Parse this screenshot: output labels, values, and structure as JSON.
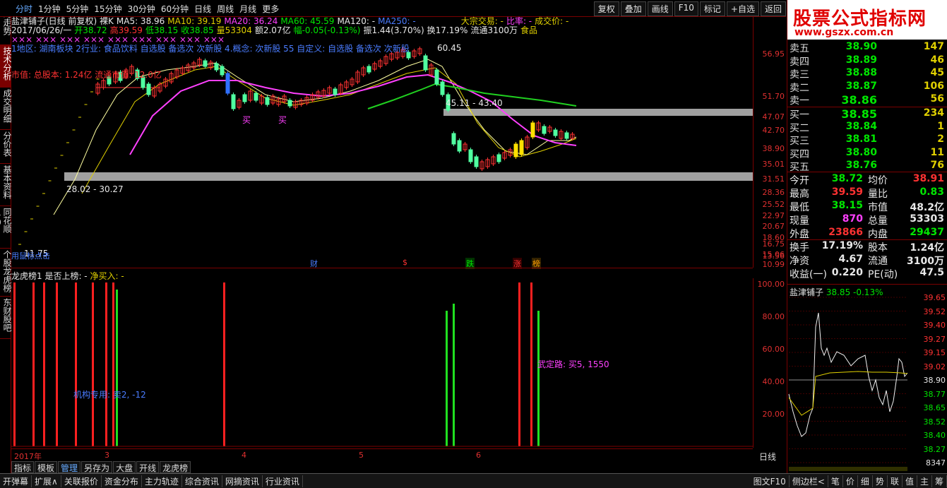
{
  "period_tabs": [
    "分时",
    "1分钟",
    "5分钟",
    "15分钟",
    "30分钟",
    "60分钟",
    "日线",
    "周线",
    "月线",
    "更多"
  ],
  "active_period": "分时",
  "toolbar": [
    "复权",
    "叠加",
    "画线",
    "F10",
    "标记",
    "+自选",
    "返回"
  ],
  "side_tabs": [
    "分时走势",
    "技术分析",
    "成交明细",
    "分价表",
    "基本资料",
    "同花顺10",
    "个股龙虎榜",
    "东财股吧"
  ],
  "active_side_tab": "技术分析",
  "header": {
    "title": "盐津铺子(日线 前复权) 裸K",
    "ma5": "MA5: 38.96",
    "ma10": "MA10: 39.19",
    "ma20": "MA20: 36.24",
    "ma60": "MA60: 45.59",
    "ma120": "MA120: -",
    "ma250": "MA250: -",
    "big_trade": "大宗交易: -",
    "ratio": "比率: -",
    "deal_price": "成交价: -",
    "date": "2017/06/26/一",
    "open": "开38.72",
    "high": "高39.59",
    "low": "低38.15",
    "close": "收38.85",
    "volume": "量53304",
    "amount": "额2.07亿",
    "change": "幅-0.05(-0.13%)",
    "amplitude": "振1.44(3.70%)",
    "turnover": "换17.19%",
    "float": "流通3100万",
    "industry_tag": "食品",
    "tags_line": "1地区: 湖南板块 2行业: 食品饮料 自选股 备选次 次新股 4.概念: 次新股 55 自定义: 自选股 备选次 次新股",
    "market_cap": "市值: 总股本: 1.24亿 流通市值: 12.0亿",
    "buy_marks": [
      "买",
      "买"
    ],
    "range_label_high": "45.11 - 43.40",
    "range_label_low": "28.02 - 30.27",
    "peak_label": "60.45",
    "low_label": "11.75",
    "low_hint": "用鼠标点击",
    "xx_marks": "×××  ×××  ×××  ×××  ×××  ×××  ×××  ×××  ×××"
  },
  "price_axis": [
    "56.95",
    "51.70",
    "47.07",
    "42.70",
    "38.90",
    "35.01",
    "31.51",
    "28.36",
    "25.52",
    "22.97",
    "20.67",
    "18.60",
    "16.75",
    "15.06",
    "13.56",
    "10.99"
  ],
  "events": [
    {
      "text": "财",
      "color": "#4a7cff",
      "bg": "#000"
    },
    {
      "text": "$",
      "color": "#ff3232",
      "bg": "#000"
    },
    {
      "text": "跌",
      "color": "#00e600",
      "bg": "#003300"
    },
    {
      "text": "涨",
      "color": "#ff3232",
      "bg": "#330000"
    },
    {
      "text": "榜",
      "color": "#ffa000",
      "bg": "#332200"
    }
  ],
  "lower_panel": {
    "title": "龙虎榜1 是否上榜: -",
    "net_buy": "净买入: -",
    "note_left": "机构专用: 卖2, -12",
    "note_right": "武定路: 买5, 1550"
  },
  "lower_axis": [
    "100.00",
    "80.00",
    "60.00",
    "40.00",
    "20.00"
  ],
  "date_axis": [
    "2017年",
    "3",
    "4",
    "5",
    "6"
  ],
  "bottom_tabs": [
    "指标",
    "模板",
    "管理",
    "另存为",
    "大盘",
    "开线",
    "龙虎榜"
  ],
  "active_bottom_tab": "管理",
  "period_label": "日线",
  "statusbar_left": [
    "开弹幕",
    "扩展∧",
    "关联报价",
    "资金分布",
    "主力轨迹",
    "综合资讯",
    "网摘资讯",
    "行业资讯"
  ],
  "statusbar_right": [
    "图文F10",
    "侧边栏<",
    "笔",
    "价",
    "细",
    "势",
    "联",
    "值",
    "主",
    "筹"
  ],
  "banner": {
    "line1": "股票公式指标网",
    "line2": "www.gszx.com.cn"
  },
  "asks": [
    {
      "label": "卖五",
      "price": "38.90",
      "vol": "147"
    },
    {
      "label": "卖四",
      "price": "38.89",
      "vol": "46"
    },
    {
      "label": "卖三",
      "price": "38.88",
      "vol": "45"
    },
    {
      "label": "卖二",
      "price": "38.87",
      "vol": "106"
    },
    {
      "label": "卖一",
      "price": "38.86",
      "vol": "56"
    }
  ],
  "bids": [
    {
      "label": "买一",
      "price": "38.85",
      "vol": "234"
    },
    {
      "label": "买二",
      "price": "38.84",
      "vol": "1"
    },
    {
      "label": "买三",
      "price": "38.81",
      "vol": "2"
    },
    {
      "label": "买四",
      "price": "38.80",
      "vol": "11"
    },
    {
      "label": "买五",
      "price": "38.76",
      "vol": "76"
    }
  ],
  "stats": [
    {
      "l1": "今开",
      "v1": "38.72",
      "c1": "down",
      "l2": "均价",
      "v2": "38.91",
      "c2": "up"
    },
    {
      "l1": "最高",
      "v1": "39.59",
      "c1": "up",
      "l2": "量比",
      "v2": "0.83",
      "c2": "down"
    },
    {
      "l1": "最低",
      "v1": "38.15",
      "c1": "down",
      "l2": "市值",
      "v2": "48.2亿",
      "c2": "white"
    },
    {
      "l1": "现量",
      "v1": "870",
      "c1": "magenta",
      "l2": "总量",
      "v2": "53303",
      "c2": "white"
    },
    {
      "l1": "外盘",
      "v1": "23866",
      "c1": "up",
      "l2": "内盘",
      "v2": "29437",
      "c2": "down"
    },
    {
      "l1": "换手",
      "v1": "17.19%",
      "c1": "white",
      "l2": "股本",
      "v2": "1.24亿",
      "c2": "white"
    },
    {
      "l1": "净资",
      "v1": "4.67",
      "c1": "white",
      "l2": "流通",
      "v2": "3100万",
      "c2": "white"
    },
    {
      "l1": "收益(一)",
      "v1": "0.220",
      "c1": "white",
      "l2": "PE(动)",
      "v2": "47.5",
      "c2": "white"
    }
  ],
  "mini_chart": {
    "name": "盐津铺子",
    "price": "38.85",
    "change": "-0.13%",
    "axis": [
      "39.65",
      "39.52",
      "39.40",
      "39.27",
      "39.15",
      "39.02",
      "38.90",
      "38.77",
      "38.65",
      "38.52",
      "38.40",
      "38.27",
      "8347"
    ]
  }
}
